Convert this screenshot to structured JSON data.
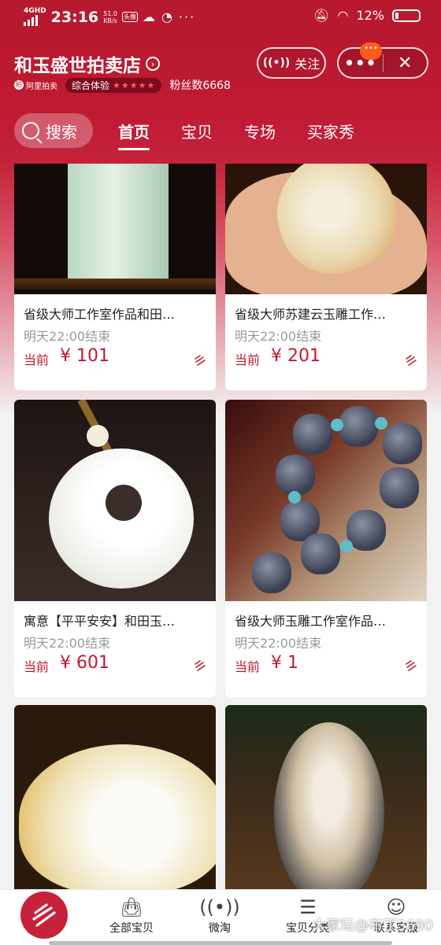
{
  "status_bar": {
    "network": "4GHD",
    "time": "23:16",
    "speed_value": "51.0",
    "speed_unit": "KB/s",
    "extra_icon": "头像",
    "more": "···",
    "battery": "12%"
  },
  "shop": {
    "name": "和玉盛世拍卖店",
    "platform": "阿里拍卖",
    "rating_label": "综合体验",
    "fans": "粉丝数6668",
    "follow_label": "关注",
    "notice_dot": "•••"
  },
  "tabs": {
    "search_label": "搜索",
    "items": [
      {
        "label": "首页"
      },
      {
        "label": "宝贝"
      },
      {
        "label": "专场"
      },
      {
        "label": "买家秀"
      }
    ]
  },
  "products": [
    {
      "title": "省级大师工作室作品和田…",
      "end": "明天22:00结束",
      "price_label": "当前",
      "price": "¥ 101"
    },
    {
      "title": "省级大师苏建云玉雕工作…",
      "end": "明天22:00结束",
      "price_label": "当前",
      "price": "¥ 201"
    },
    {
      "title": "寓意【平平安安】和田玉…",
      "end": "明天22:00结束",
      "price_label": "当前",
      "price": "¥ 601"
    },
    {
      "title": "省级大师玉雕工作室作品…",
      "end": "明天22:00结束",
      "price_label": "当前",
      "price": "¥ 1"
    }
  ],
  "bottom_nav": {
    "items": [
      {
        "label": "全部宝贝"
      },
      {
        "label": "微淘"
      },
      {
        "label": "宝贝分类"
      },
      {
        "label": "联系客服"
      }
    ]
  },
  "watermark": "大家坛@布丁3690",
  "colors": {
    "brand": "#c01a33",
    "price": "#c01a33"
  }
}
